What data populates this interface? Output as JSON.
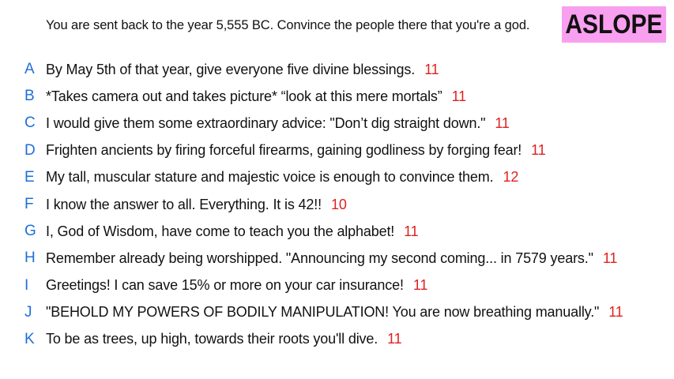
{
  "prompt": "You are sent back to the year 5,555 BC. Convince the people there that you're a god.",
  "brand": "ASLOPE",
  "colors": {
    "badge_bg": "#f99ff0",
    "letter": "#1e6fd9",
    "score": "#e02020"
  },
  "answers": [
    {
      "letter": "A",
      "text": "By May 5th of that year, give everyone five divine blessings.",
      "score": "11"
    },
    {
      "letter": "B",
      "text": "*Takes camera out and takes picture* “look at this mere mortals”",
      "score": "11"
    },
    {
      "letter": "C",
      "text": "I would give them some extraordinary advice: \"Don’t dig straight down.\"",
      "score": "11"
    },
    {
      "letter": "D",
      "text": "Frighten ancients by firing forceful firearms, gaining godliness by forging fear!",
      "score": "11"
    },
    {
      "letter": "E",
      "text": "My tall, muscular stature and majestic voice is enough to convince them.",
      "score": "12"
    },
    {
      "letter": "F",
      "text": "I know the answer to all. Everything. It is 42!!",
      "score": "10"
    },
    {
      "letter": "G",
      "text": "I, God of Wisdom, have come to teach you the alphabet!",
      "score": "11"
    },
    {
      "letter": "H",
      "text": "Remember already being worshipped. \"Announcing my second coming... in 7579 years.\"",
      "score": "11"
    },
    {
      "letter": "I",
      "text": "Greetings! I can save 15% or more on your car insurance!",
      "score": "11"
    },
    {
      "letter": "J",
      "text": "\"BEHOLD MY POWERS OF BODILY MANIPULATION! You are now breathing manually.\"",
      "score": "11"
    },
    {
      "letter": "K",
      "text": "To be as trees, up high, towards their roots you'll dive.",
      "score": "11"
    }
  ]
}
